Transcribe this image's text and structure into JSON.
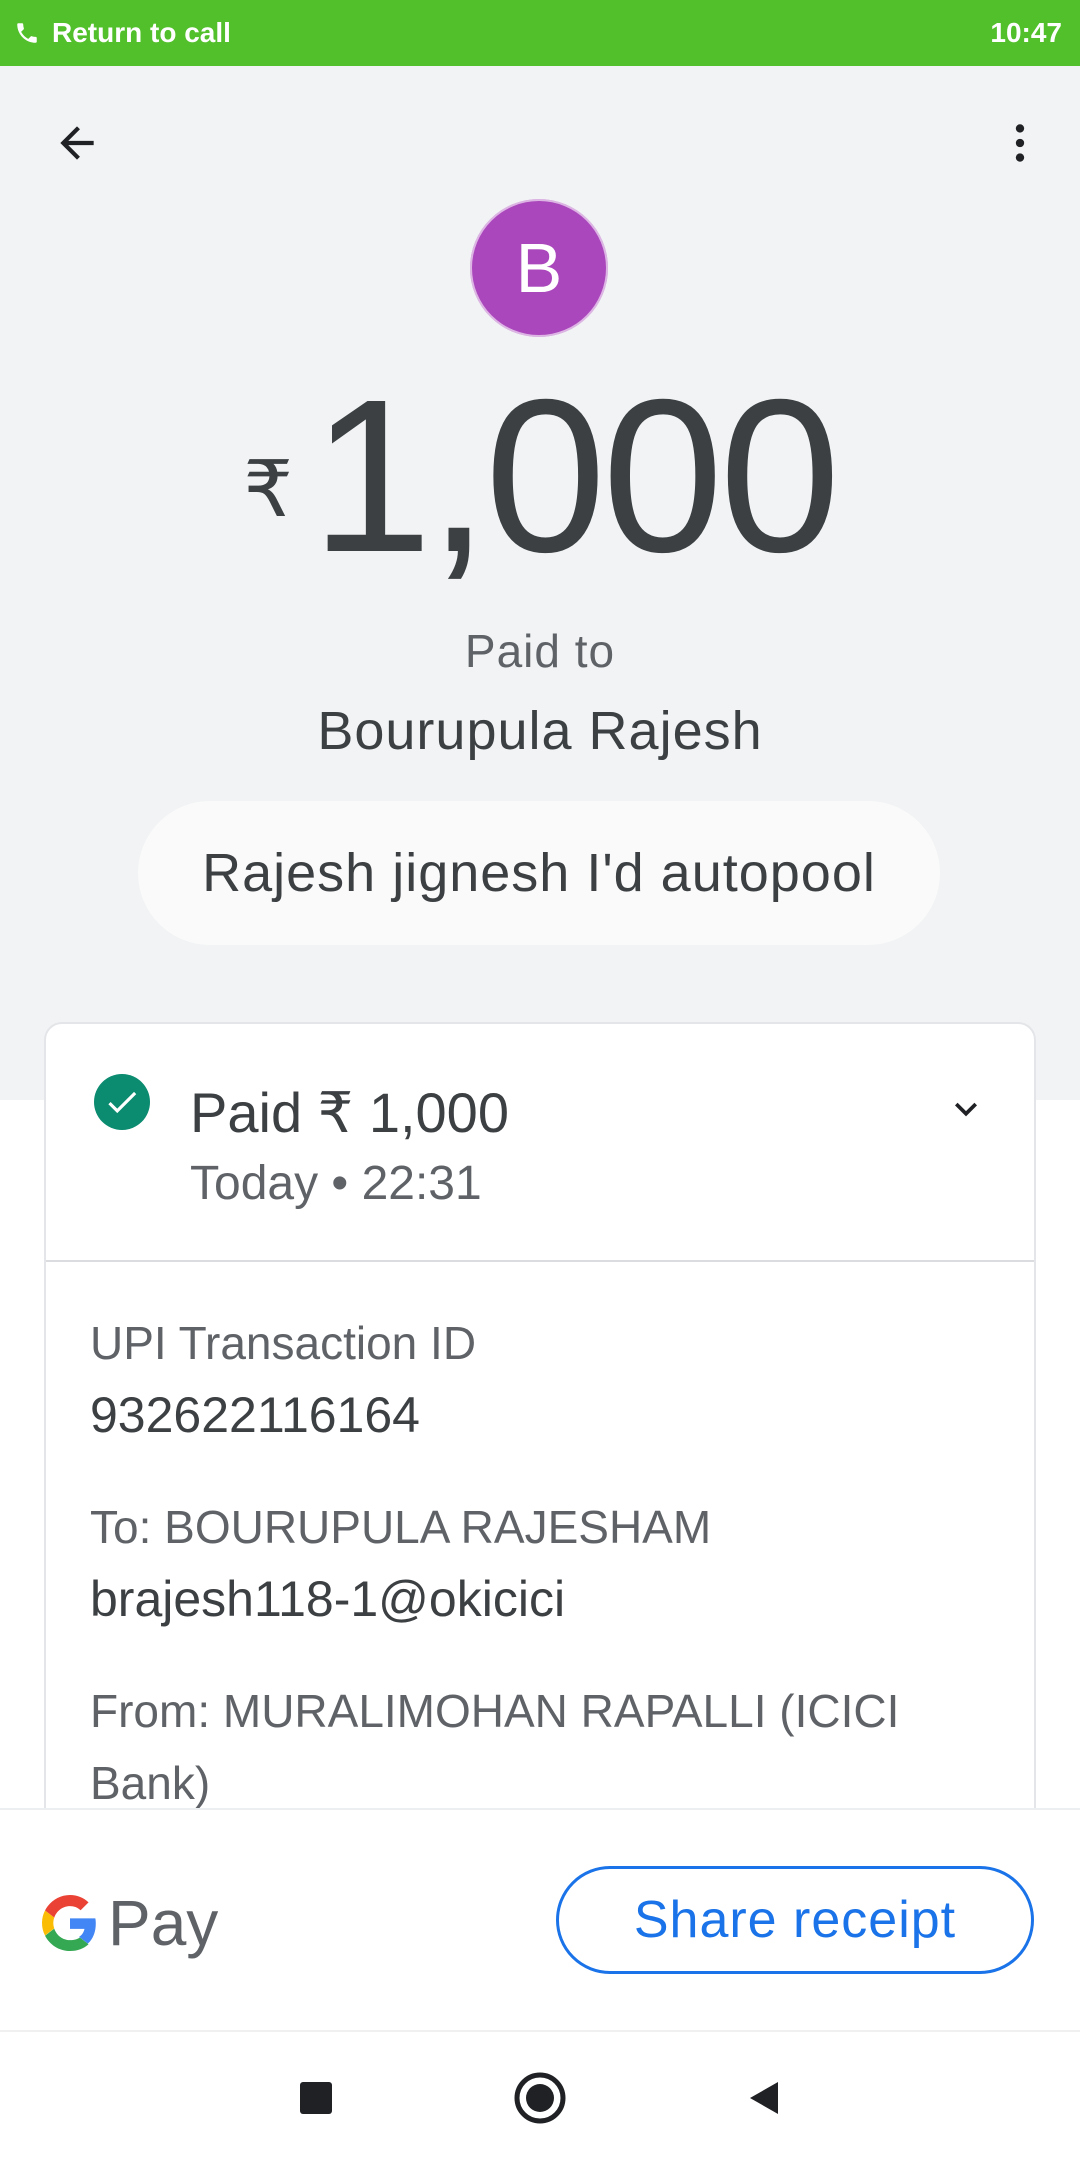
{
  "status_bar": {
    "call_label": "Return to call",
    "time": "10:47",
    "color": "#52c02b",
    "icon": "phone-icon"
  },
  "header": {
    "back_icon": "back-arrow-icon",
    "menu_icon": "more-vert-icon"
  },
  "payee": {
    "avatar_letter": "B",
    "avatar_color": "#ab47bc",
    "currency_symbol": "₹",
    "amount": "1,000",
    "paid_to_label": "Paid to",
    "name": "Bourupula Rajesh",
    "note": "Rajesh jignesh I'd autopool"
  },
  "transaction": {
    "status_icon": "check-circle-icon",
    "status_color": "#0b8b6f",
    "paid_text": "Paid ₹ 1,000",
    "date_text": "Today • 22:31",
    "upi_label": "UPI Transaction ID",
    "upi_value": "932622116164",
    "to_label": "To: BOURUPULA RAJESHAM",
    "to_value": "brajesh118-1@okicici",
    "from_label_line1": "From: MURALIMOHAN RAPALLI (ICICI",
    "from_label_line2": "Bank)"
  },
  "footer": {
    "brand_g": "G",
    "brand_pay": "Pay",
    "share_label": "Share receipt",
    "accent": "#1a73e8"
  },
  "nav": {
    "recent_icon": "square-icon",
    "home_icon": "circle-home-icon",
    "back_icon": "triangle-back-icon"
  }
}
